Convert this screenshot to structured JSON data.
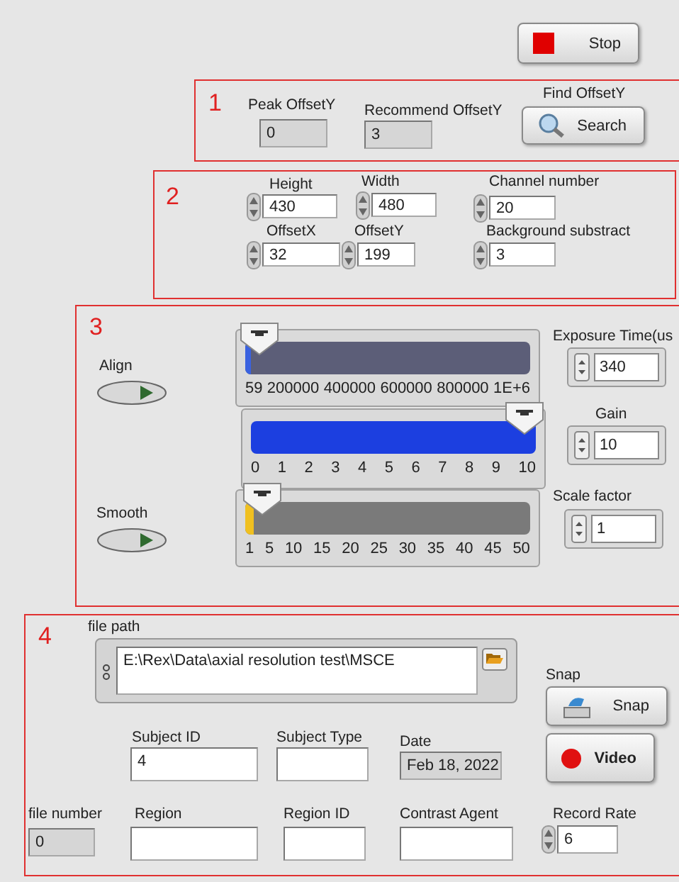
{
  "stop_button": {
    "label": "Stop"
  },
  "section_1": {
    "number": "1",
    "peak_offset_y": {
      "label": "Peak OffsetY",
      "value": "0"
    },
    "recommend_offset_y": {
      "label": "Recommend OffsetY",
      "value": "3"
    },
    "find_offset_y": {
      "label": "Find OffsetY",
      "button": "Search"
    }
  },
  "section_2": {
    "number": "2",
    "fields": [
      {
        "label": "Height",
        "value": "430"
      },
      {
        "label": "Width",
        "value": "480"
      },
      {
        "label": "Channel number",
        "value": "20"
      },
      {
        "label": "OffsetX",
        "value": "32"
      },
      {
        "label": "OffsetY",
        "value": "199"
      },
      {
        "label": "Background substract",
        "value": "3"
      }
    ]
  },
  "section_3": {
    "number": "3",
    "toggles": [
      {
        "label": "Align",
        "on": false
      },
      {
        "label": "Smooth",
        "on": false
      }
    ],
    "sliders": [
      {
        "level": 0.02,
        "color": "#3a62e0",
        "scale": [
          "59",
          "200000",
          "400000",
          "600000",
          "800000",
          "1E+6"
        ]
      },
      {
        "level": 1,
        "color": "#1c3fe0",
        "scale": [
          "0",
          "1",
          "2",
          "3",
          "4",
          "5",
          "6",
          "7",
          "8",
          "9",
          "10"
        ]
      },
      {
        "level": 0.03,
        "color": "#f0c020",
        "scale": [
          "1",
          "5",
          "10",
          "15",
          "20",
          "25",
          "30",
          "35",
          "40",
          "45",
          "50"
        ]
      }
    ],
    "numerics": [
      {
        "label": "Exposure Time(us",
        "value": "340"
      },
      {
        "label": "Gain",
        "value": "10"
      },
      {
        "label": "Scale factor",
        "value": "1"
      }
    ]
  },
  "section_4": {
    "number": "4",
    "file_path": {
      "label": "file path",
      "value": "E:\\Rex\\Data\\axial resolution test\\MSCE"
    },
    "snap": {
      "label": "Snap",
      "button": "Snap"
    },
    "video_button": {
      "label": "Video"
    },
    "fields": [
      {
        "label": "Subject ID",
        "value": "4",
        "kind": "input"
      },
      {
        "label": "Subject Type",
        "kind": "input"
      },
      {
        "label": "Date",
        "value": "Feb 18, 2022",
        "kind": "indicator"
      },
      {
        "label": "file number",
        "value": "0",
        "kind": "indicator"
      },
      {
        "label": "Region",
        "kind": "input"
      },
      {
        "label": "Region ID",
        "kind": "input"
      },
      {
        "label": "Contrast Agent",
        "kind": "input"
      },
      {
        "label": "Record Rate",
        "value": "6",
        "kind": "spinner"
      }
    ]
  }
}
